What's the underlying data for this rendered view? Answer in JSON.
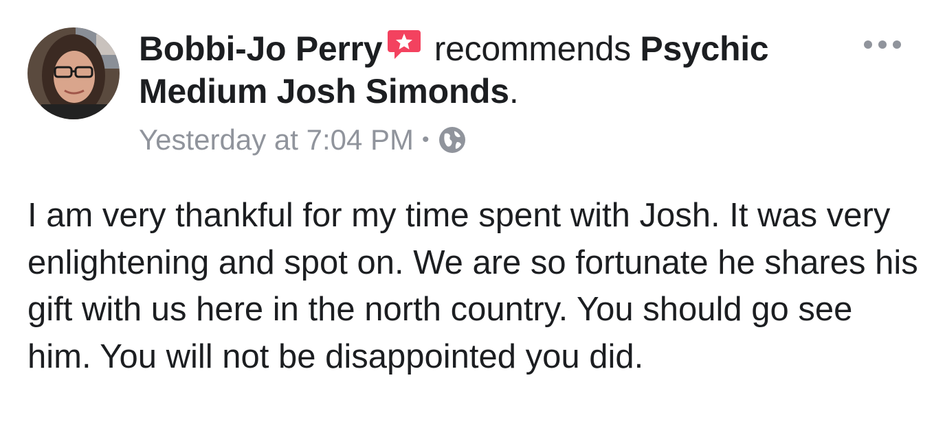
{
  "post": {
    "author_name": "Bobbi-Jo Perry",
    "action_text": "recommends",
    "page_name_line1": "Psychic",
    "page_name_line2": "Medium Josh Simonds",
    "period": ".",
    "timestamp": "Yesterday at 7:04 PM",
    "separator": "•",
    "privacy_icon": "globe-icon",
    "recommendation_icon": "recommendation-star-icon",
    "menu_icon": "more-options-icon",
    "text": "I am very thankful for my time spent with Josh. It was very enlightening and spot on. We are so fortunate he shares his gift with us here in the north country. You should go see him. You will not be disappointed you did."
  },
  "colors": {
    "text": "#1c1e21",
    "meta": "#90949c",
    "recommend_badge": "#f3425f",
    "menu_dots": "#90949c"
  }
}
